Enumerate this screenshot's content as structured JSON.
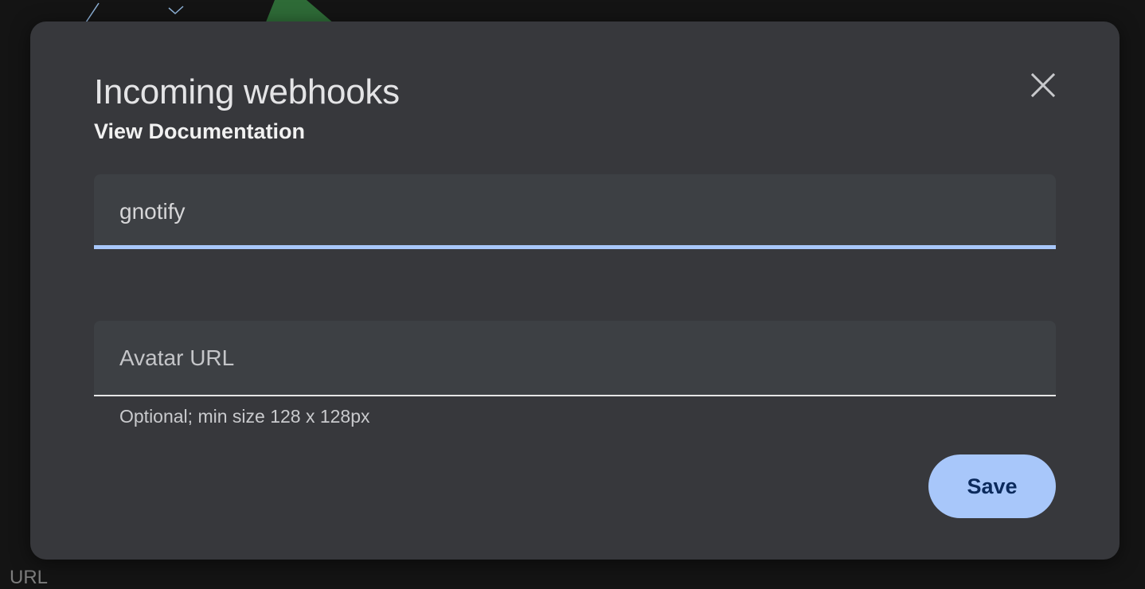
{
  "background": {
    "partial_label": "URL"
  },
  "dialog": {
    "title": "Incoming webhooks",
    "doc_link": "View Documentation",
    "close_icon": "close-icon",
    "name_field": {
      "value": "gnotify"
    },
    "avatar_field": {
      "placeholder": "Avatar URL",
      "helper": "Optional; min size 128 x 128px"
    },
    "save_label": "Save"
  },
  "colors": {
    "page_background": "#141414",
    "dialog_surface": "#37383c",
    "field_surface": "#3d4044",
    "accent": "#a8c7fa",
    "button_text": "#0b2a5c",
    "bg_shape_green": "#2e6b37",
    "bg_shape_line": "#8fb3d9"
  }
}
